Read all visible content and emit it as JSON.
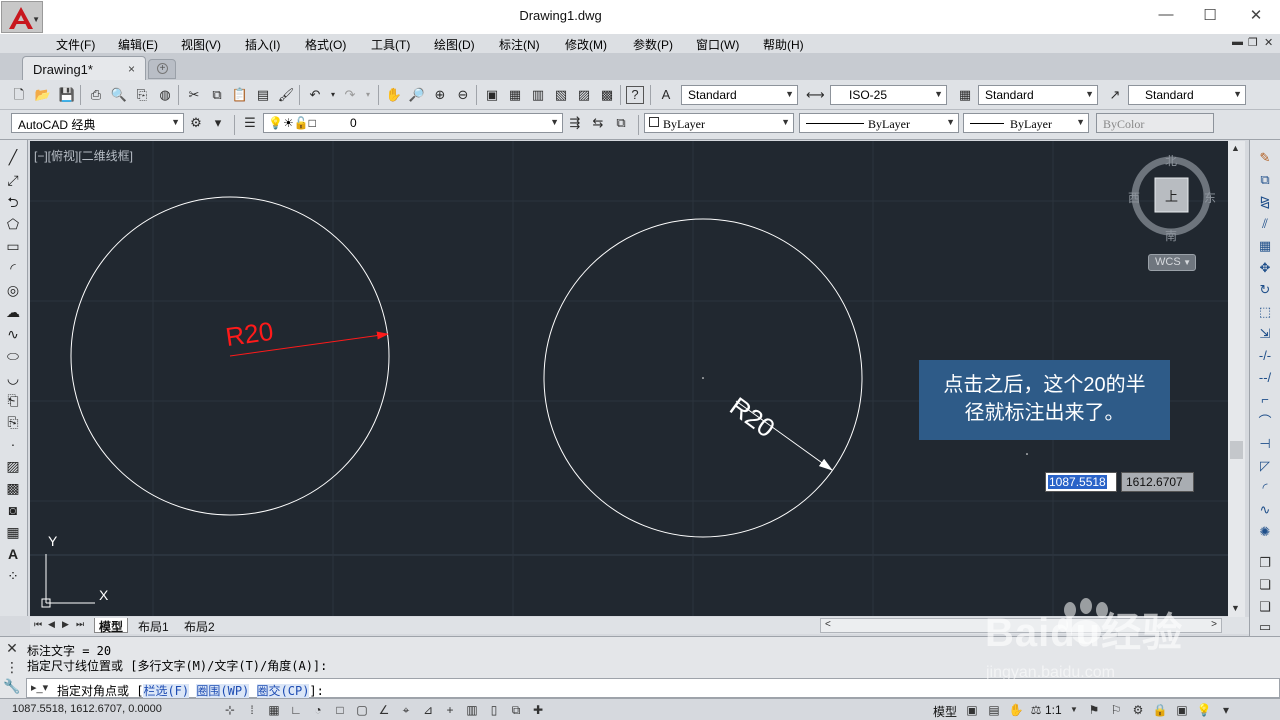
{
  "window": {
    "title": "Drawing1.dwg",
    "controls": [
      "—",
      "☐",
      "✕"
    ]
  },
  "menu": {
    "items": [
      "文件(F)",
      "编辑(E)",
      "视图(V)",
      "插入(I)",
      "格式(O)",
      "工具(T)",
      "绘图(D)",
      "标注(N)",
      "修改(M)",
      "参数(P)",
      "窗口(W)",
      "帮助(H)"
    ]
  },
  "tabs": {
    "document": "Drawing1*",
    "close": "×"
  },
  "toolbar1": {
    "text_style": "Standard",
    "dim_style": "ISO-25",
    "table_style": "Standard",
    "mleader_style": "Standard"
  },
  "toolbar2": {
    "workspace": "AutoCAD 经典",
    "layer": "0",
    "color": "ByLayer",
    "linetype": "ByLayer",
    "lineweight": "ByLayer",
    "plotstyle": "ByColor"
  },
  "viewport": {
    "label": "[−][俯视][二维线框]"
  },
  "drawing": {
    "left_dim": "R20",
    "right_dim": "R20",
    "ucs_y": "Y",
    "ucs_x": "X"
  },
  "compass": {
    "north": "北",
    "south": "南",
    "east": "东",
    "west": "西",
    "center": "上",
    "wcs": "WCS"
  },
  "callout": {
    "line1": "点击之后，这个20的半",
    "line2": "径就标注出来了。"
  },
  "dynamic_input": {
    "value1": "1087.5518",
    "value2": "1612.6707"
  },
  "layout_tabs": {
    "model": "模型",
    "layout1": "布局1",
    "layout2": "布局2"
  },
  "command": {
    "history1": "标注文字 = 20",
    "history2": "指定尺寸线位置或 [多行文字(M)/文字(T)/角度(A)]:",
    "prompt_prefix": "指定对角点或 [",
    "kw1": "栏选(F)",
    "kw2": "圈围(WP)",
    "kw3": "圈交(CP)",
    "prompt_suffix": "]:"
  },
  "status": {
    "coords": "1087.5518,  1612.6707, 0.0000",
    "model": "模型",
    "scale": "1:1"
  },
  "watermark": {
    "brand": "Baidu经验",
    "url": "jingyan.baidu.com"
  },
  "colors": {
    "canvas_bg": "#212830",
    "dim_red": "#ff1a1a",
    "callout_bg": "#2e5b88",
    "ui_bg": "#dfe2e6"
  }
}
